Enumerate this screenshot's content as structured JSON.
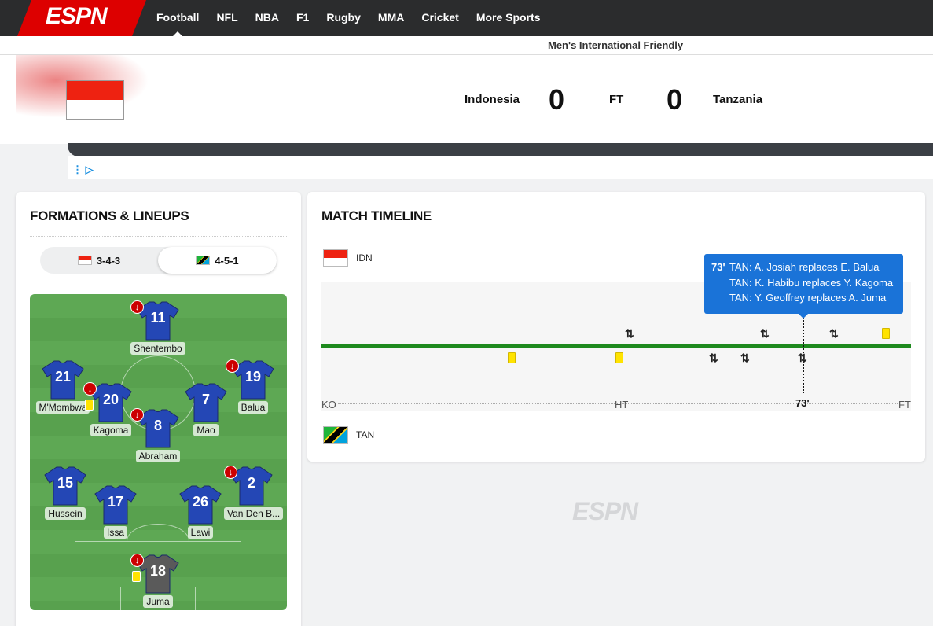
{
  "nav": {
    "logo": "ESPN",
    "links": [
      "Football",
      "NFL",
      "NBA",
      "F1",
      "Rugby",
      "MMA",
      "Cricket",
      "More Sports"
    ]
  },
  "competition": "Men's International Friendly",
  "match": {
    "home_team": "Indonesia",
    "away_team": "Tanzania",
    "home_score": "0",
    "away_score": "0",
    "status": "FT"
  },
  "lineups": {
    "title": "FORMATIONS & LINEUPS",
    "home_formation": "3-4-3",
    "away_formation": "4-5-1",
    "players": [
      {
        "num": "11",
        "name": "Shentembo",
        "sub": true,
        "yellow": false
      },
      {
        "num": "21",
        "name": "M'Mombwa",
        "sub": false,
        "yellow": false
      },
      {
        "num": "20",
        "name": "Kagoma",
        "sub": true,
        "yellow": true
      },
      {
        "num": "8",
        "name": "Abraham",
        "sub": true,
        "yellow": false
      },
      {
        "num": "7",
        "name": "Mao",
        "sub": false,
        "yellow": false
      },
      {
        "num": "19",
        "name": "Balua",
        "sub": true,
        "yellow": false
      },
      {
        "num": "15",
        "name": "Hussein",
        "sub": false,
        "yellow": false
      },
      {
        "num": "17",
        "name": "Issa",
        "sub": false,
        "yellow": false
      },
      {
        "num": "26",
        "name": "Lawi",
        "sub": false,
        "yellow": false
      },
      {
        "num": "2",
        "name": "Van Den B...",
        "sub": true,
        "yellow": false
      },
      {
        "num": "18",
        "name": "Juma",
        "sub": true,
        "yellow": true
      }
    ]
  },
  "timeline": {
    "title": "MATCH TIMELINE",
    "home_abbr": "IDN",
    "away_abbr": "TAN",
    "labels": {
      "ko": "KO",
      "ht": "HT",
      "ft": "FT",
      "selected": "73'"
    },
    "tooltip": {
      "minute": "73'",
      "lines": [
        "TAN: A. Josiah replaces E. Balua",
        "TAN: K. Habibu replaces Y. Kagoma",
        "TAN: Y. Geoffrey replaces A. Juma"
      ]
    }
  },
  "watermark": "ESPN",
  "colors": {
    "espn_red": "#dd0000",
    "pitch_green": "#5ea854",
    "timeline_green": "#1e8a1e",
    "tooltip_blue": "#1a73d8",
    "yellow_card": "#ffe300",
    "shirt_blue": "#2447b5",
    "gk_shirt": "#5a5a5a"
  }
}
